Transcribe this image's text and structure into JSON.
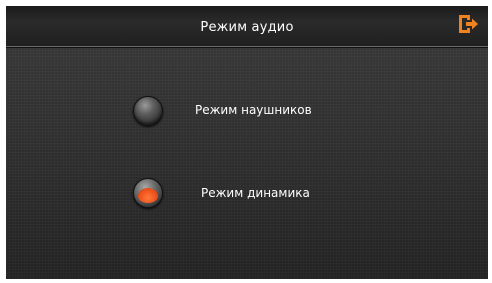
{
  "header": {
    "title": "Режим аудио",
    "exit_icon": "exit-icon",
    "exit_color": "#f0831e"
  },
  "options": [
    {
      "label": "Режим наушников",
      "selected": false
    },
    {
      "label": "Режим динамика",
      "selected": true
    }
  ],
  "colors": {
    "selected_indicator": "#f0531c",
    "background": "#2d2d2d",
    "text": "#ffffff"
  }
}
